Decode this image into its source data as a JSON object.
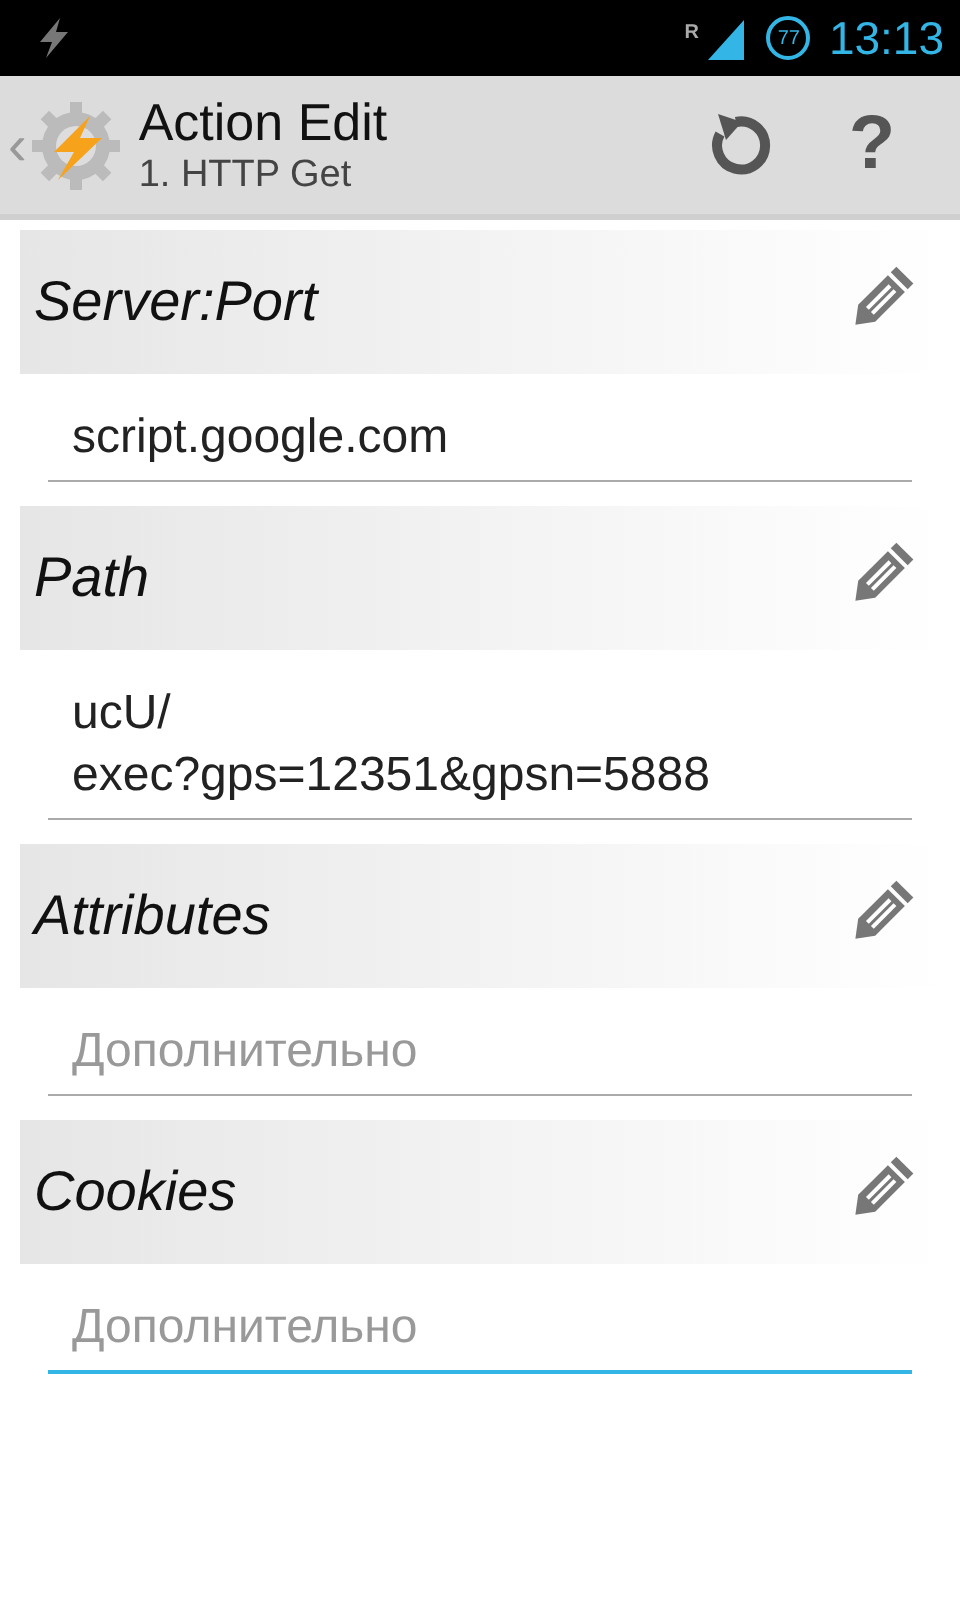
{
  "status_bar": {
    "roaming": "R",
    "battery": "77",
    "time": "13:13"
  },
  "action_bar": {
    "back": "‹",
    "title": "Action Edit",
    "subtitle": "1. HTTP Get",
    "buttons": [
      {
        "kind": "undo"
      },
      {
        "kind": "help",
        "label": "?"
      }
    ]
  },
  "sections": [
    {
      "label": "Server:Port",
      "value_lines": [
        "script.google.com"
      ],
      "focused": false
    },
    {
      "label": "Path",
      "value_lines": [
        "ucU/",
        "exec?gps=12351&gpsn=5888"
      ],
      "focused": false
    },
    {
      "label": "Attributes",
      "placeholder": "Дополнительно",
      "focused": false
    },
    {
      "label": "Cookies",
      "placeholder": "Дополнительно",
      "focused": true
    }
  ]
}
